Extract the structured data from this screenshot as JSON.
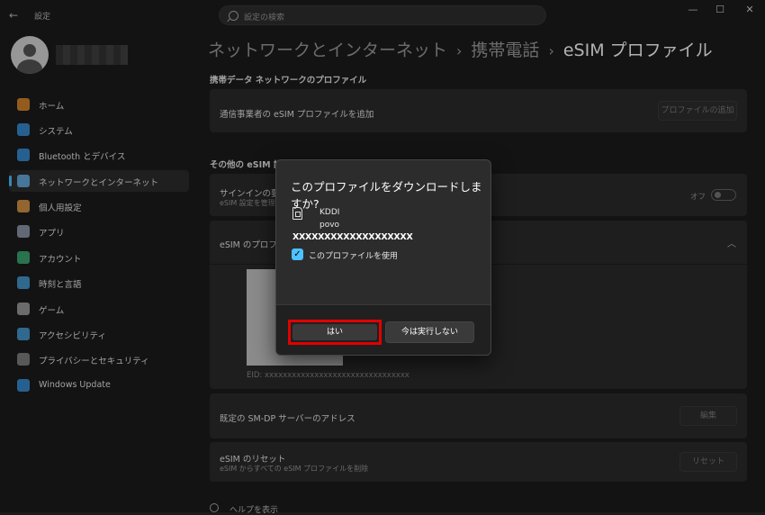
{
  "window": {
    "title": "設定",
    "back": "←",
    "min": "—",
    "max": "☐",
    "close": "✕"
  },
  "search": {
    "placeholder": "設定の検索"
  },
  "nav": [
    {
      "label": "ホーム",
      "icon": "home-icon",
      "color": "#e8912d"
    },
    {
      "label": "システム",
      "icon": "system-icon",
      "color": "#3b97e3"
    },
    {
      "label": "Bluetooth とデバイス",
      "icon": "bluetooth-icon",
      "color": "#3b97e3"
    },
    {
      "label": "ネットワークとインターネット",
      "icon": "network-icon",
      "color": "#6cb8f0",
      "selected": true
    },
    {
      "label": "個人用設定",
      "icon": "brush-icon",
      "color": "#e8a04a"
    },
    {
      "label": "アプリ",
      "icon": "apps-icon",
      "color": "#9aa4b8"
    },
    {
      "label": "アカウント",
      "icon": "account-icon",
      "color": "#3fb57a"
    },
    {
      "label": "時刻と言語",
      "icon": "globe-clock-icon",
      "color": "#4aa3e0"
    },
    {
      "label": "ゲーム",
      "icon": "gamepad-icon",
      "color": "#a9a9a9"
    },
    {
      "label": "アクセシビリティ",
      "icon": "accessibility-icon",
      "color": "#4aa3e0"
    },
    {
      "label": "プライバシーとセキュリティ",
      "icon": "shield-icon",
      "color": "#8a8a8a"
    },
    {
      "label": "Windows Update",
      "icon": "update-icon",
      "color": "#3b97e3"
    }
  ],
  "breadcrumb": {
    "part1": "ネットワークとインターネット",
    "part2": "携帯電話",
    "current": "eSIM プロファイル",
    "sep": "›"
  },
  "sections": {
    "carrier_profiles": "携帯データ ネットワークのプロファイル",
    "other_settings": "その他の eSIM 設定"
  },
  "cards": {
    "add_profile": {
      "label": "通信事業者の eSIM プロファイルを追加",
      "button": "プロファイルの追加"
    },
    "signin": {
      "label": "サインインの要件",
      "sub": "eSIM 設定を管理",
      "toggle_text": "オフ"
    },
    "esim_profile": {
      "label": "eSIM のプロファイル",
      "eid": "EID: xxxxxxxxxxxxxxxxxxxxxxxxxxxxxxxx"
    },
    "smdp": {
      "label": "既定の SM-DP サーバーのアドレス",
      "button": "編集"
    },
    "reset": {
      "label": "eSIM のリセット",
      "sub": "eSIM からすべての eSIM プロファイルを削除",
      "button": "リセット"
    }
  },
  "help": "ヘルプを表示",
  "dialog": {
    "title": "このプロファイルをダウンロードしますか?",
    "carrier": "KDDI",
    "plan": "povo",
    "number": "XXXXXXXXXXXXXXXXXXX",
    "checkbox_label": "このプロファイルを使用",
    "checkbox_checked": true,
    "yes": "はい",
    "no": "今は実行しない"
  }
}
